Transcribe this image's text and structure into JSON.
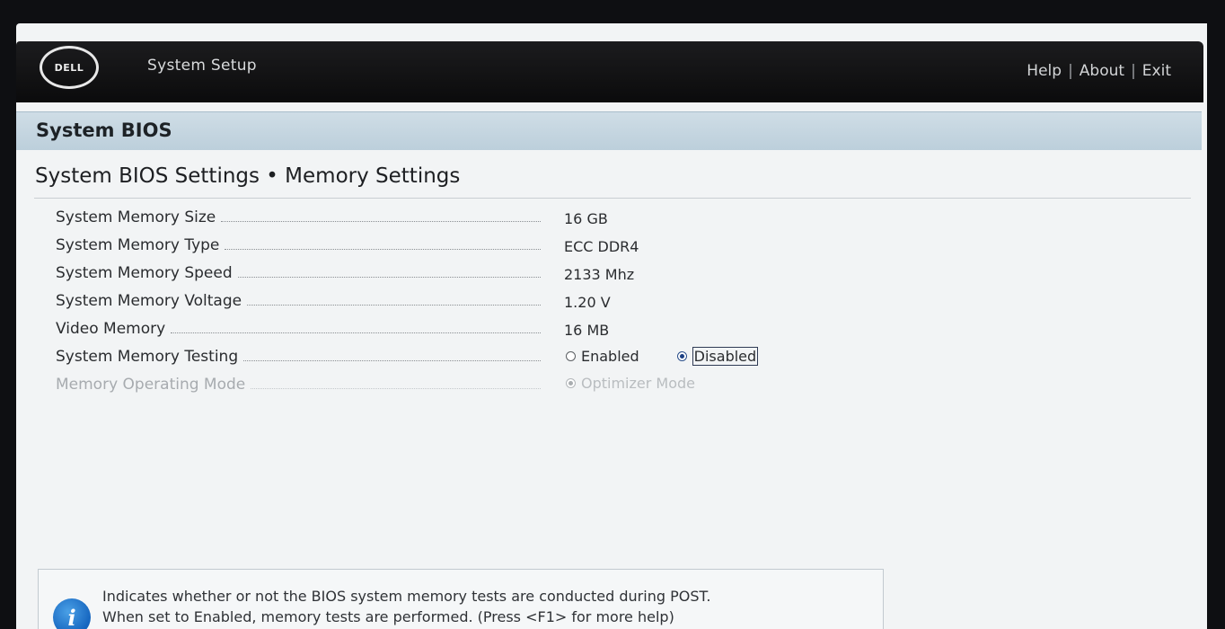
{
  "header": {
    "logo_text": "DELL",
    "app_title": "System Setup",
    "links": [
      "Help",
      "About",
      "Exit"
    ],
    "separator": "|"
  },
  "title_band": "System BIOS",
  "page_heading": "System BIOS Settings • Memory Settings",
  "rows": [
    {
      "label": "System Memory Size",
      "value": "16 GB"
    },
    {
      "label": "System Memory Type",
      "value": "ECC DDR4"
    },
    {
      "label": "System Memory Speed",
      "value": "2133 Mhz"
    },
    {
      "label": "System Memory Voltage",
      "value": "1.20 V"
    },
    {
      "label": "Video Memory",
      "value": "16 MB"
    },
    {
      "label": "System Memory Testing",
      "options": [
        "Enabled",
        "Disabled"
      ],
      "selected": "Disabled"
    },
    {
      "label": "Memory Operating Mode",
      "options": [
        "Optimizer Mode"
      ],
      "selected": "Optimizer Mode",
      "disabled": true
    }
  ],
  "help": {
    "icon": "info-icon",
    "line1": "Indicates whether or not the BIOS system memory tests are conducted during POST.",
    "line2": "When set to Enabled, memory tests are performed. (Press <F1> for more help)"
  },
  "colors": {
    "header_bg": "#111113",
    "title_band_bg": "#c6d7e2",
    "page_bg": "#f2f4f5",
    "info_icon": "#1e73c8"
  }
}
